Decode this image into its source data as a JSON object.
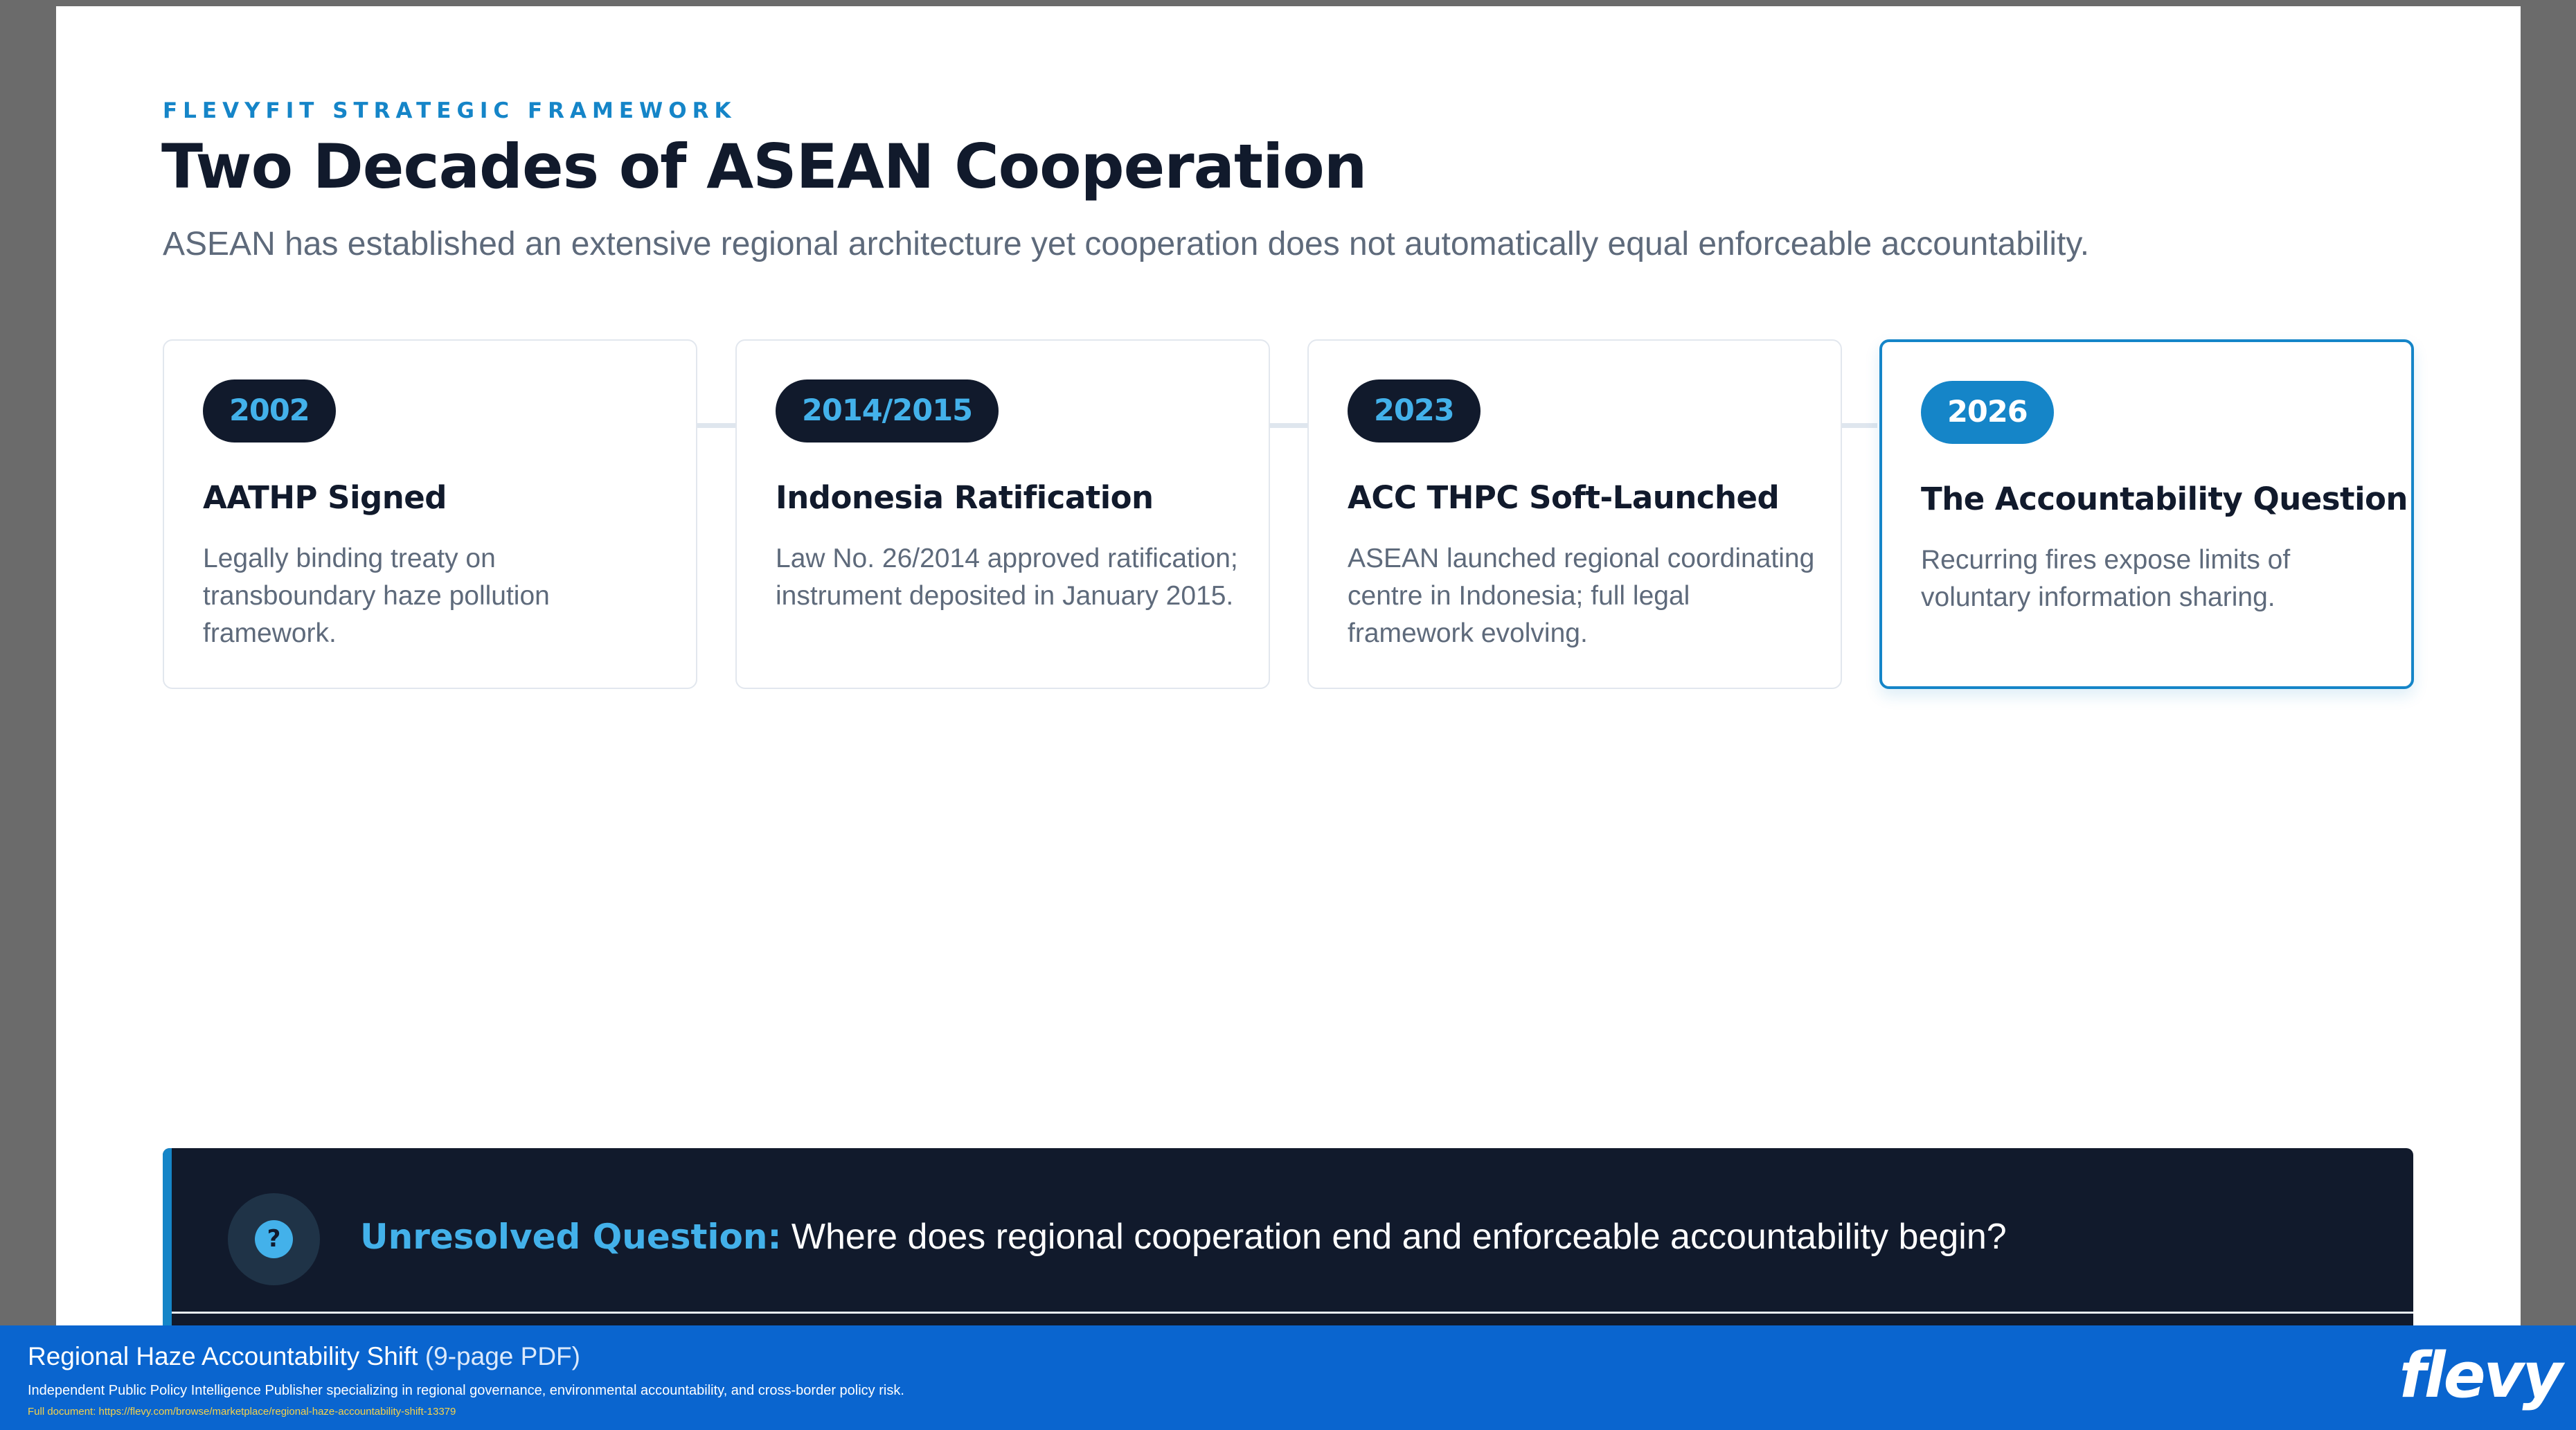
{
  "header": {
    "eyebrow": "FLEVYFIT STRATEGIC FRAMEWORK",
    "title": "Two Decades of ASEAN Cooperation",
    "subtitle": "ASEAN has established an extensive regional architecture yet cooperation does not automatically equal enforceable accountability."
  },
  "timeline": [
    {
      "year": "2002",
      "title": "AATHP Signed",
      "description": "Legally binding treaty on transboundary haze pollution framework."
    },
    {
      "year": "2014/2015",
      "title": "Indonesia Ratification",
      "description": "Law No. 26/2014 approved ratification; instrument deposited in January 2015."
    },
    {
      "year": "2023",
      "title": "ACC THPC Soft-Launched",
      "description": "ASEAN launched regional coordinating centre in Indonesia; full legal framework evolving."
    },
    {
      "year": "2026",
      "title": "The Accountability Question",
      "description": "Recurring fires expose limits of voluntary information sharing."
    }
  ],
  "question": {
    "icon": "question-icon",
    "icon_glyph": "?",
    "label": "Unresolved Question:",
    "text": " Where does regional cooperation end and enforceable accountability begin?"
  },
  "footer": {
    "title": "Regional Haze Accountability Shift",
    "pages": " (9-page PDF)",
    "description": "Independent Public Policy Intelligence Publisher specializing in regional governance, environmental accountability, and cross-border policy risk.",
    "link": "Full document: https://flevy.com/browse/marketplace/regional-haze-accountability-shift-13379",
    "logo": "flevy"
  },
  "colors": {
    "accent": "#1585c8",
    "navy": "#111a2c",
    "light_blue": "#43b1ea",
    "footer_blue": "#0a65cf"
  }
}
